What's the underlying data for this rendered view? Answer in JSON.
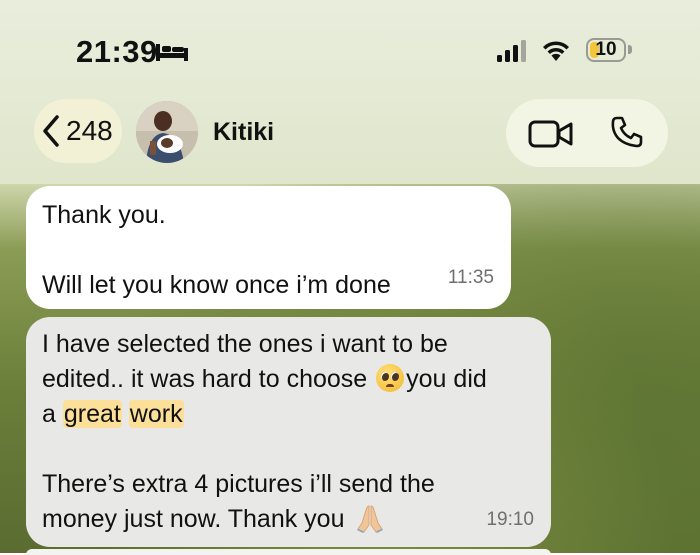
{
  "status_bar": {
    "time": "21:39",
    "battery_level": "10",
    "icons": [
      "bed-icon",
      "signal-icon",
      "wifi-icon",
      "battery-icon"
    ]
  },
  "nav": {
    "back_count": "248",
    "contact_name": "Kitiki",
    "icons": [
      "chevron-left-icon",
      "video-call-icon",
      "phone-call-icon"
    ]
  },
  "messages": [
    {
      "direction": "outgoing",
      "lines": [
        "Thank you.",
        "",
        "Will let you know once i’m done"
      ],
      "time": "11:35"
    },
    {
      "direction": "incoming",
      "line1": "I have selected the ones i want to be",
      "line2a": "edited.. it was hard to choose",
      "emoji1": "pleading-face",
      "line2b": "you did",
      "line3a": "a",
      "hl1": "great",
      "hl2": "work",
      "line4": "There’s extra 4 pictures i’ll send the",
      "line5": "money just now. Thank you",
      "emoji2": "folded-hands",
      "time": "19:10"
    }
  ],
  "colors": {
    "outgoing_bubble": "#ffffff",
    "incoming_bubble": "#e8e8e6",
    "highlight": "#fce09a",
    "battery_low": "#f3c53b"
  }
}
